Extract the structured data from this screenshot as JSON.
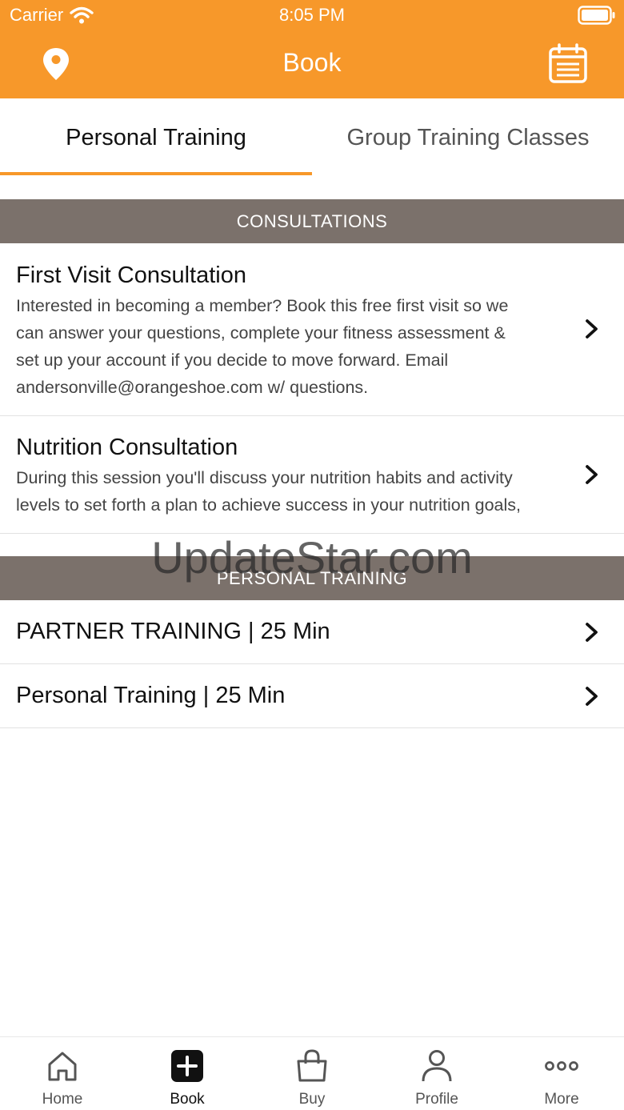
{
  "status_bar": {
    "carrier": "Carrier",
    "time": "8:05 PM"
  },
  "nav": {
    "title": "Book",
    "left_icon": "location-pin-icon",
    "right_icon": "calendar-icon"
  },
  "tabs": [
    {
      "label": "Personal Training",
      "active": true
    },
    {
      "label": "Group Training Classes",
      "active": false
    }
  ],
  "sections": [
    {
      "header": "CONSULTATIONS",
      "items": [
        {
          "title": "First Visit Consultation",
          "lines": [
            "Interested in becoming a member? Book this free first visit so we",
            "can answer your questions, complete your fitness assessment &",
            "set up your account if you decide to move forward. Email",
            "andersonville@orangeshoe.com w/ questions."
          ]
        },
        {
          "title": "Nutrition Consultation",
          "lines": [
            "During this session you'll discuss your nutrition habits and activity",
            "levels to set forth a plan to achieve success in your nutrition goals,"
          ]
        }
      ]
    },
    {
      "header": "PERSONAL TRAINING",
      "items": [
        {
          "title": "PARTNER TRAINING | 25 Min"
        },
        {
          "title": "Personal Training | 25 Min"
        }
      ]
    }
  ],
  "watermark": "UpdateStar.com",
  "tabbar": [
    {
      "label": "Home",
      "icon": "home-icon",
      "active": false
    },
    {
      "label": "Book",
      "icon": "plus-square-icon",
      "active": true
    },
    {
      "label": "Buy",
      "icon": "shopping-bag-icon",
      "active": false
    },
    {
      "label": "Profile",
      "icon": "person-icon",
      "active": false
    },
    {
      "label": "More",
      "icon": "more-dots-icon",
      "active": false
    }
  ],
  "colors": {
    "accent": "#f7982a",
    "section_header": "#7b716b"
  }
}
